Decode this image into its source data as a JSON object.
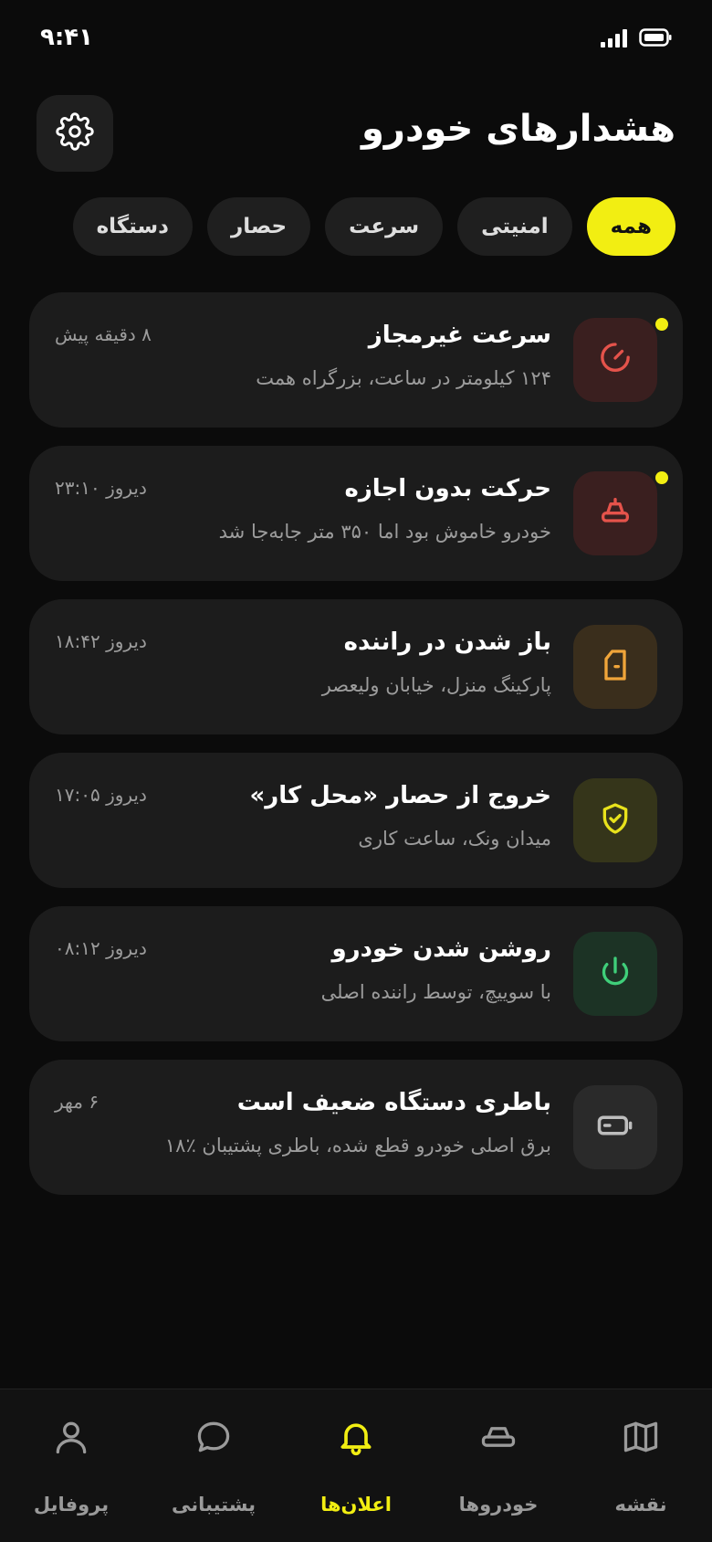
{
  "status_bar": {
    "time": "۹:۴۱"
  },
  "header": {
    "title": "هشدارهای خودرو",
    "settings_icon": "gear-icon"
  },
  "filters": [
    {
      "label": "همه",
      "active": true
    },
    {
      "label": "امنیتی",
      "active": false
    },
    {
      "label": "سرعت",
      "active": false
    },
    {
      "label": "حصار",
      "active": false
    },
    {
      "label": "دستگاه",
      "active": false
    }
  ],
  "alerts": [
    {
      "title": "سرعت غیرمجاز",
      "desc": "۱۲۴ کیلومتر در ساعت، بزرگراه همت",
      "time": "۸ دقیقه پیش",
      "icon": "speedometer-icon",
      "color": "#e5534b",
      "bg": "#3a1f1f",
      "unread": true
    },
    {
      "title": "حرکت بدون اجازه",
      "desc": "خودرو خاموش بود اما ۳۵۰ متر جابه‌جا شد",
      "time": "دیروز ۲۳:۱۰",
      "icon": "car-icon",
      "color": "#e5534b",
      "bg": "#3a1f1f",
      "unread": true
    },
    {
      "title": "باز شدن در راننده",
      "desc": "پارکینگ منزل، خیابان ولیعصر",
      "time": "دیروز ۱۸:۴۲",
      "icon": "door-icon",
      "color": "#f0a53a",
      "bg": "#3a2e1c",
      "unread": false
    },
    {
      "title": "خروج از حصار «محل کار»",
      "desc": "میدان ونک، ساعت کاری",
      "time": "دیروز ۱۷:۰۵",
      "icon": "shield-check-icon",
      "color": "#e8e21c",
      "bg": "#35351a",
      "unread": false
    },
    {
      "title": "روشن شدن خودرو",
      "desc": "با سوییچ، توسط راننده اصلی",
      "time": "دیروز ۰۸:۱۲",
      "icon": "power-icon",
      "color": "#3fcf7a",
      "bg": "#1c3325",
      "unread": false
    },
    {
      "title": "باطری دستگاه ضعیف است",
      "desc": "برق اصلی خودرو قطع شده، باطری پشتیبان ٪۱۸",
      "time": "۶ مهر",
      "icon": "battery-icon",
      "color": "#bdbdbd",
      "bg": "#2a2a2a",
      "unread": false
    }
  ],
  "bottom_nav": [
    {
      "label": "نقشه",
      "icon": "map-icon",
      "active": false
    },
    {
      "label": "خودروها",
      "icon": "car-icon",
      "active": false
    },
    {
      "label": "اعلان‌ها",
      "icon": "bell-icon",
      "active": true
    },
    {
      "label": "پشتیبانی",
      "icon": "chat-icon",
      "active": false
    },
    {
      "label": "پروفایل",
      "icon": "user-icon",
      "active": false
    }
  ],
  "colors": {
    "accent": "#f2ee12",
    "background": "#0b0b0b",
    "card": "#1c1c1c"
  }
}
